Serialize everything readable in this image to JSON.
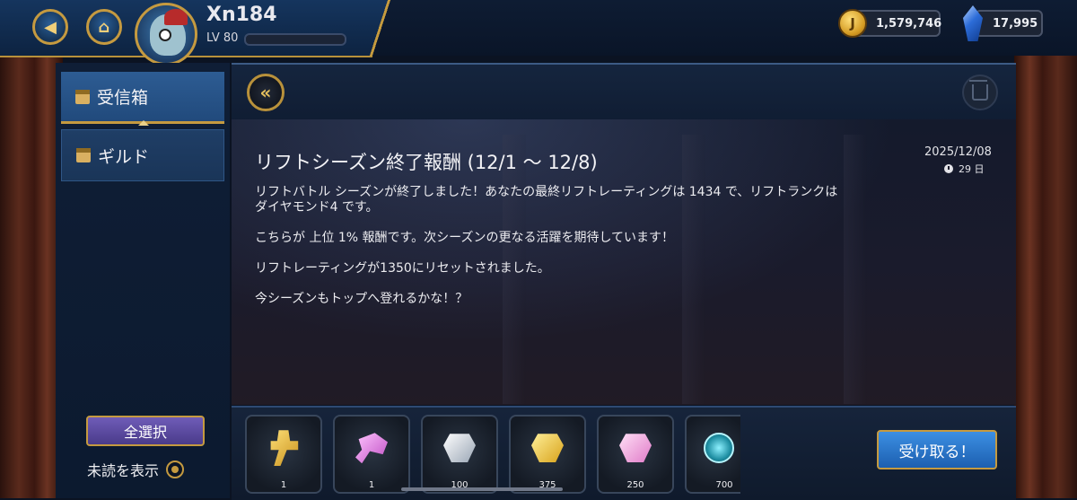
{
  "header": {
    "username": "Xn184",
    "level_label": "LV 80",
    "coins": "1,579,746",
    "gems": "17,995"
  },
  "sidebar": {
    "items": [
      {
        "label": "受信箱"
      },
      {
        "label": "ギルド"
      }
    ],
    "select_all": "全選択",
    "show_unread": "未読を表示"
  },
  "mail": {
    "title": "リフトシーズン終了報酬 (12/1 ～ 12/8)",
    "date": "2025/12/08",
    "days_left": "29 日",
    "body": [
      "リフトバトル シーズンが終了しました！あなたの最終リフトレーティングは 1434 で、リフトランクは",
      "ダイヤモンド4 です。",
      "こちらが 上位 1%  報酬です。次シーズンの更なる活躍を期待しています！",
      "リフトレーティングが1350にリセットされました。",
      "今シーズンもトップへ登れるかな！？"
    ]
  },
  "rewards": [
    {
      "name": "gold-key",
      "qty": "1"
    },
    {
      "name": "pink-key",
      "qty": "1"
    },
    {
      "name": "silver-ore",
      "qty": "100"
    },
    {
      "name": "gold-ore",
      "qty": "375"
    },
    {
      "name": "pink-ore",
      "qty": "250"
    },
    {
      "name": "teal-orb",
      "qty": "700"
    }
  ],
  "receive_button": "受け取る！"
}
